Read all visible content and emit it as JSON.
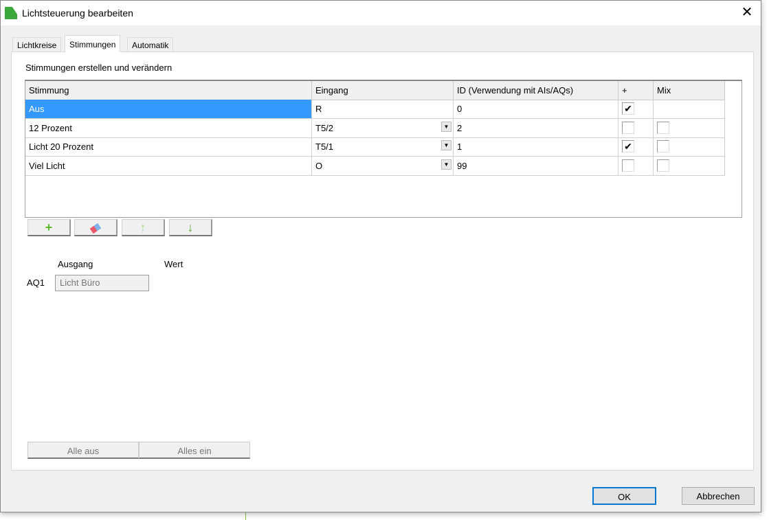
{
  "window": {
    "title": "Lichtsteuerung bearbeiten"
  },
  "tabs": [
    {
      "label": "Lichtkreise"
    },
    {
      "label": "Stimmungen"
    },
    {
      "label": "Automatik"
    }
  ],
  "panel": {
    "title": "Stimmungen erstellen und verändern"
  },
  "grid": {
    "headers": [
      "Stimmung",
      "Eingang",
      "ID (Verwendung mit AIs/AQs)",
      "+",
      "Mix"
    ],
    "rows": [
      {
        "stimmung": "Aus",
        "eingang": "R",
        "id": "0",
        "plus": true,
        "mix": null,
        "dropdown": false,
        "selected": true
      },
      {
        "stimmung": "12 Prozent",
        "eingang": "T5/2",
        "id": "2",
        "plus": false,
        "mix": false,
        "dropdown": true
      },
      {
        "stimmung": "Licht 20 Prozent",
        "eingang": "T5/1",
        "id": "1",
        "plus": true,
        "mix": false,
        "dropdown": true
      },
      {
        "stimmung": "Viel Licht",
        "eingang": "O",
        "id": "99",
        "plus": false,
        "mix": false,
        "dropdown": true
      }
    ]
  },
  "toolbar": {
    "add": "+",
    "erase": "eraser-icon",
    "up": "↑",
    "down": "↓"
  },
  "output": {
    "ausgang_label": "Ausgang",
    "wert_label": "Wert",
    "aq_label": "AQ1",
    "aq_value": "Licht Büro"
  },
  "bottom": {
    "all_off": "Alle aus",
    "all_on": "Alles ein"
  },
  "dialog_buttons": {
    "ok": "OK",
    "cancel": "Abbrechen"
  },
  "colors": {
    "selection": "#3399ff",
    "accent": "#0078d7"
  }
}
